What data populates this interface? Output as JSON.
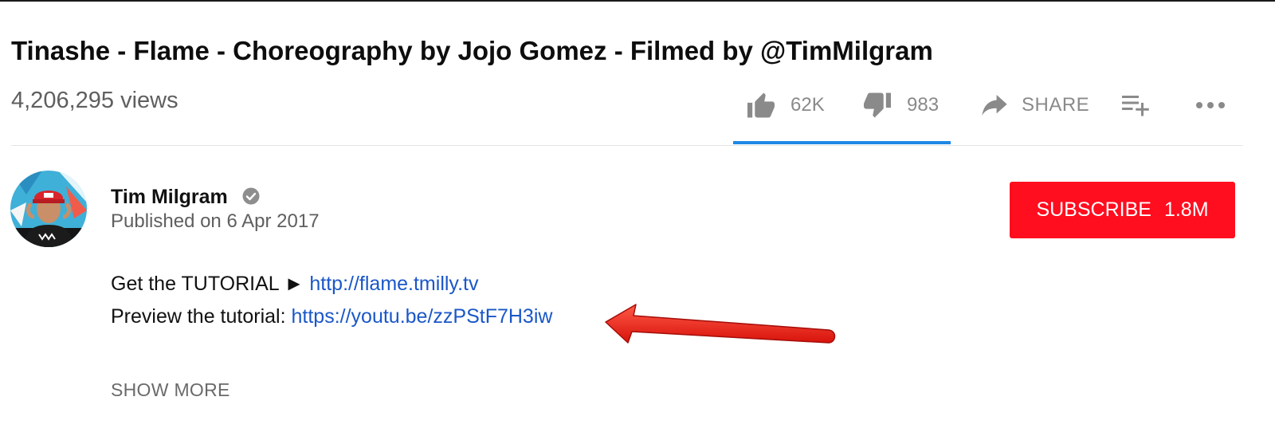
{
  "video": {
    "title": "Tinashe - Flame - Choreography by Jojo Gomez - Filmed by @TimMilgram",
    "views": "4,206,295 views"
  },
  "actions": {
    "like_count": "62K",
    "dislike_count": "983",
    "share_label": "SHARE",
    "like_ratio": 0.984
  },
  "channel": {
    "name": "Tim Milgram",
    "published": "Published on 6 Apr 2017",
    "verified": true
  },
  "subscribe": {
    "label": "SUBSCRIBE",
    "count": "1.8M"
  },
  "description": {
    "line1_prefix": "Get the TUTORIAL ► ",
    "line1_link": "http://flame.tmilly.tv",
    "line2_prefix": "Preview the tutorial: ",
    "line2_link": "https://youtu.be/zzPStF7H3iw",
    "show_more": "SHOW MORE"
  },
  "icons": {
    "like": "thumbs-up-icon",
    "dislike": "thumbs-down-icon",
    "share": "share-arrow-icon",
    "save": "playlist-add-icon",
    "more": "more-horizontal-icon",
    "verified": "verified-check-icon",
    "annotation": "red-arrow-annotation"
  },
  "colors": {
    "subscribe_bg": "#ff0e1f",
    "link": "#1a57c8",
    "sentiment_bar": "#1e88e5",
    "annotation_arrow": "#e8231c"
  }
}
